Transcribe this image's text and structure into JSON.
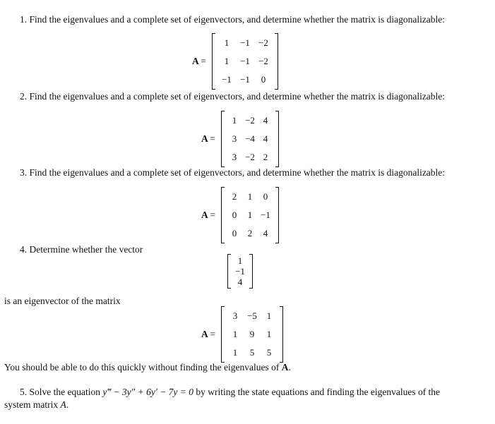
{
  "problems": [
    {
      "text": "1. Find the eigenvalues and a complete set of eigenvectors, and determine whether the matrix is diagonalizable:",
      "matrix_label": "A",
      "matrix": [
        [
          "1",
          "−1",
          "−2"
        ],
        [
          "1",
          "−1",
          "−2"
        ],
        [
          "−1",
          "−1",
          "0"
        ]
      ]
    },
    {
      "text": "2. Find the eigenvalues and a complete set of eigenvectors, and determine whether the matrix is diagonalizable:",
      "matrix_label": "A",
      "matrix": [
        [
          "1",
          "−2",
          "4"
        ],
        [
          "3",
          "−4",
          "4"
        ],
        [
          "3",
          "−2",
          "2"
        ]
      ]
    },
    {
      "text": "3. Find the eigenvalues and a complete set of eigenvectors, and determine whether the matrix is diagonalizable:",
      "matrix_label": "A",
      "matrix": [
        [
          "2",
          "1",
          "0"
        ],
        [
          "0",
          "1",
          "−1"
        ],
        [
          "0",
          "2",
          "4"
        ]
      ]
    },
    {
      "text": "4. Determine whether the vector",
      "vector": [
        "1",
        "−1",
        "4"
      ],
      "text2": "is an eigenvector of the matrix",
      "matrix_label": "A",
      "matrix": [
        [
          "3",
          "−5",
          "1"
        ],
        [
          "1",
          "9",
          "1"
        ],
        [
          "1",
          "5",
          "5"
        ]
      ],
      "note_prefix": "You should be able to do this quickly without finding the eigenvalues of ",
      "note_bold": "A",
      "note_suffix": "."
    },
    {
      "line1_prefix": "5. Solve the equation ",
      "equation": "y‴ − 3y″ + 6y′ − 7y = 0",
      "line1_suffix": " by writing the state equations and finding the eigenvalues of the",
      "line2_prefix": "system matrix ",
      "line2_italic": "A",
      "line2_suffix": "."
    }
  ],
  "equals": "="
}
